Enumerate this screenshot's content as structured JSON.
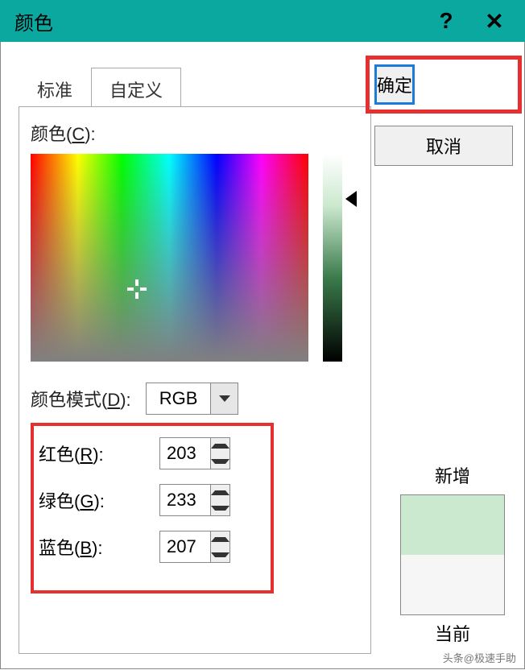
{
  "titlebar": {
    "title": "颜色"
  },
  "tabs": {
    "standard": "标准",
    "custom": "自定义"
  },
  "labels": {
    "colors": "颜色",
    "colors_key": "C",
    "mode": "颜色模式",
    "mode_key": "D",
    "mode_value": "RGB",
    "red": "红色",
    "red_key": "R",
    "green": "绿色",
    "green_key": "G",
    "blue": "蓝色",
    "blue_key": "B"
  },
  "values": {
    "red": "203",
    "green": "233",
    "blue": "207"
  },
  "buttons": {
    "ok": "确定",
    "cancel": "取消"
  },
  "preview": {
    "new": "新增",
    "current": "当前"
  },
  "colors_meta": {
    "selected": "#cbe9cf",
    "current": "#f6f6f6"
  },
  "watermark": "头条@极速手助"
}
